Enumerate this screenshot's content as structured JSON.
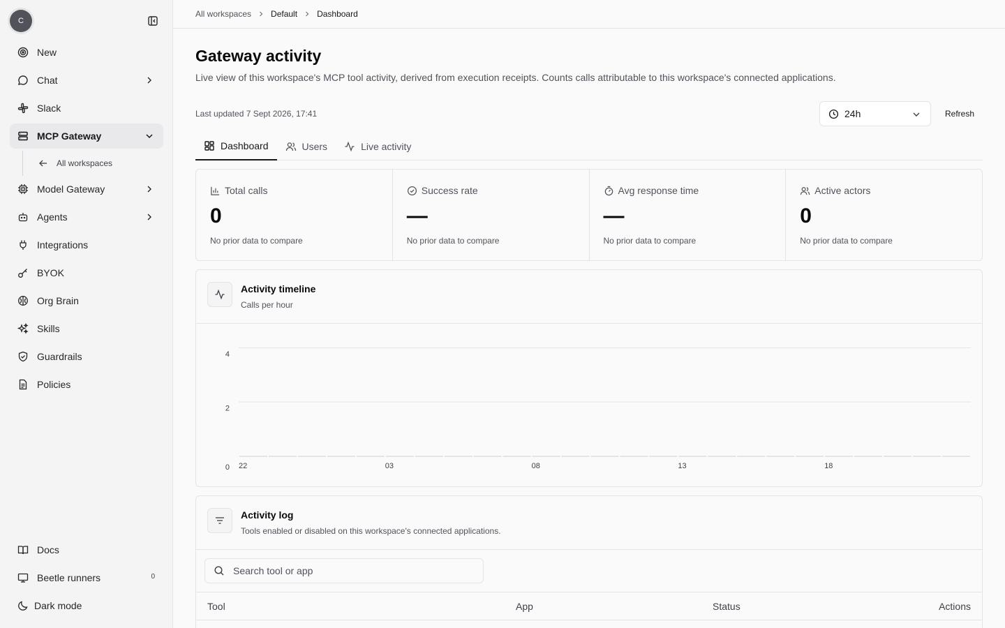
{
  "sidebar": {
    "avatar_initial": "C",
    "items": [
      {
        "label": "New",
        "icon": "target-icon"
      },
      {
        "label": "Chat",
        "icon": "chat-bubble-icon"
      },
      {
        "label": "Slack",
        "icon": "slack-icon"
      },
      {
        "label": "MCP Gateway",
        "icon": "server-icon"
      },
      {
        "label": "Model Gateway",
        "icon": "cpu-icon"
      },
      {
        "label": "Agents",
        "icon": "bot-icon"
      },
      {
        "label": "Integrations",
        "icon": "plug-icon"
      },
      {
        "label": "BYOK",
        "icon": "key-icon"
      },
      {
        "label": "Org Brain",
        "icon": "brain-icon"
      },
      {
        "label": "Skills",
        "icon": "sparkles-icon"
      },
      {
        "label": "Guardrails",
        "icon": "shield-icon"
      },
      {
        "label": "Policies",
        "icon": "document-icon"
      }
    ],
    "sub_item": {
      "label": "All workspaces",
      "icon": "arrow-left-icon"
    },
    "bottom": [
      {
        "label": "Docs",
        "icon": "book-icon"
      },
      {
        "label": "Beetle runners",
        "icon": "monitor-icon",
        "badge": "0"
      },
      {
        "label": "Dark mode",
        "icon": "moon-icon"
      }
    ]
  },
  "breadcrumb": [
    "All workspaces",
    "Default",
    "Dashboard"
  ],
  "page": {
    "title": "Gateway activity",
    "description": "Live view of this workspace's MCP tool activity, derived from execution receipts. Counts calls attributable to this workspace's connected applications.",
    "last_updated": "Last updated 7 Sept 2026, 17:41",
    "range": "24h",
    "refresh_label": "Refresh"
  },
  "tabs": [
    {
      "label": "Dashboard",
      "icon": "dashboard-icon",
      "active": true
    },
    {
      "label": "Users",
      "icon": "users-icon"
    },
    {
      "label": "Live activity",
      "icon": "activity-icon"
    }
  ],
  "stats": [
    {
      "label": "Total calls",
      "value": "0",
      "note": "No prior data to compare",
      "icon": "bar-chart-icon"
    },
    {
      "label": "Success rate",
      "value": "—",
      "note": "No prior data to compare",
      "icon": "check-circle-icon"
    },
    {
      "label": "Avg response time",
      "value": "—",
      "note": "No prior data to compare",
      "icon": "timer-icon"
    },
    {
      "label": "Active actors",
      "value": "0",
      "note": "No prior data to compare",
      "icon": "users-icon"
    }
  ],
  "timeline": {
    "title": "Activity timeline",
    "subtitle": "Calls per hour"
  },
  "chart_data": {
    "type": "bar",
    "ylim": [
      0,
      4
    ],
    "yticks": [
      "4",
      "2",
      "0"
    ],
    "xticks": [
      "22",
      "03",
      "08",
      "13",
      "18"
    ],
    "values": [
      0,
      0,
      0,
      0,
      0,
      0,
      0,
      0,
      0,
      0,
      0,
      0,
      0,
      0,
      0,
      0,
      0,
      0,
      0,
      0,
      0,
      0,
      0,
      0,
      0
    ],
    "grid": true
  },
  "log": {
    "title": "Activity log",
    "subtitle": "Tools enabled or disabled on this workspace's connected applications.",
    "search_placeholder": "Search tool or app",
    "columns": [
      "Tool",
      "App",
      "Status",
      "Actions"
    ]
  }
}
